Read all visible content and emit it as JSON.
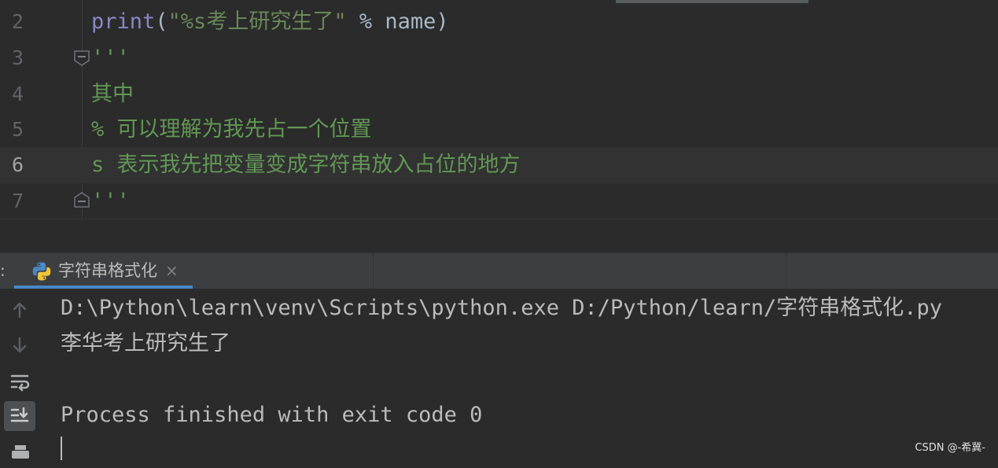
{
  "editor": {
    "lines": [
      {
        "number": "2",
        "tokens": {
          "fn": "print",
          "open": "(",
          "str": "\"%s考上研究生了\"",
          "rest": " % name)"
        }
      },
      {
        "number": "3",
        "text": "'''"
      },
      {
        "number": "4",
        "text": "其中"
      },
      {
        "number": "5",
        "text": "% 可以理解为我先占一个位置"
      },
      {
        "number": "6",
        "text": "s 表示我先把变量变成字符串放入占位的地方"
      },
      {
        "number": "7",
        "text": "'''"
      }
    ],
    "current_line": "6"
  },
  "run_panel": {
    "header_prefix": ":",
    "tab_label": "字符串格式化",
    "tab_close": "×",
    "tab_icon": "python-icon",
    "accent_color": "#4a88c7",
    "sidebar_icons": [
      "up-arrow-icon",
      "down-arrow-icon",
      "soft-wrap-icon",
      "scroll-to-end-icon",
      "print-icon"
    ],
    "console_lines": [
      "D:\\Python\\learn\\venv\\Scripts\\python.exe D:/Python/learn/字符串格式化.py",
      "李华考上研究生了",
      "",
      "Process finished with exit code 0"
    ]
  },
  "watermark": "CSDN @-希冀-"
}
